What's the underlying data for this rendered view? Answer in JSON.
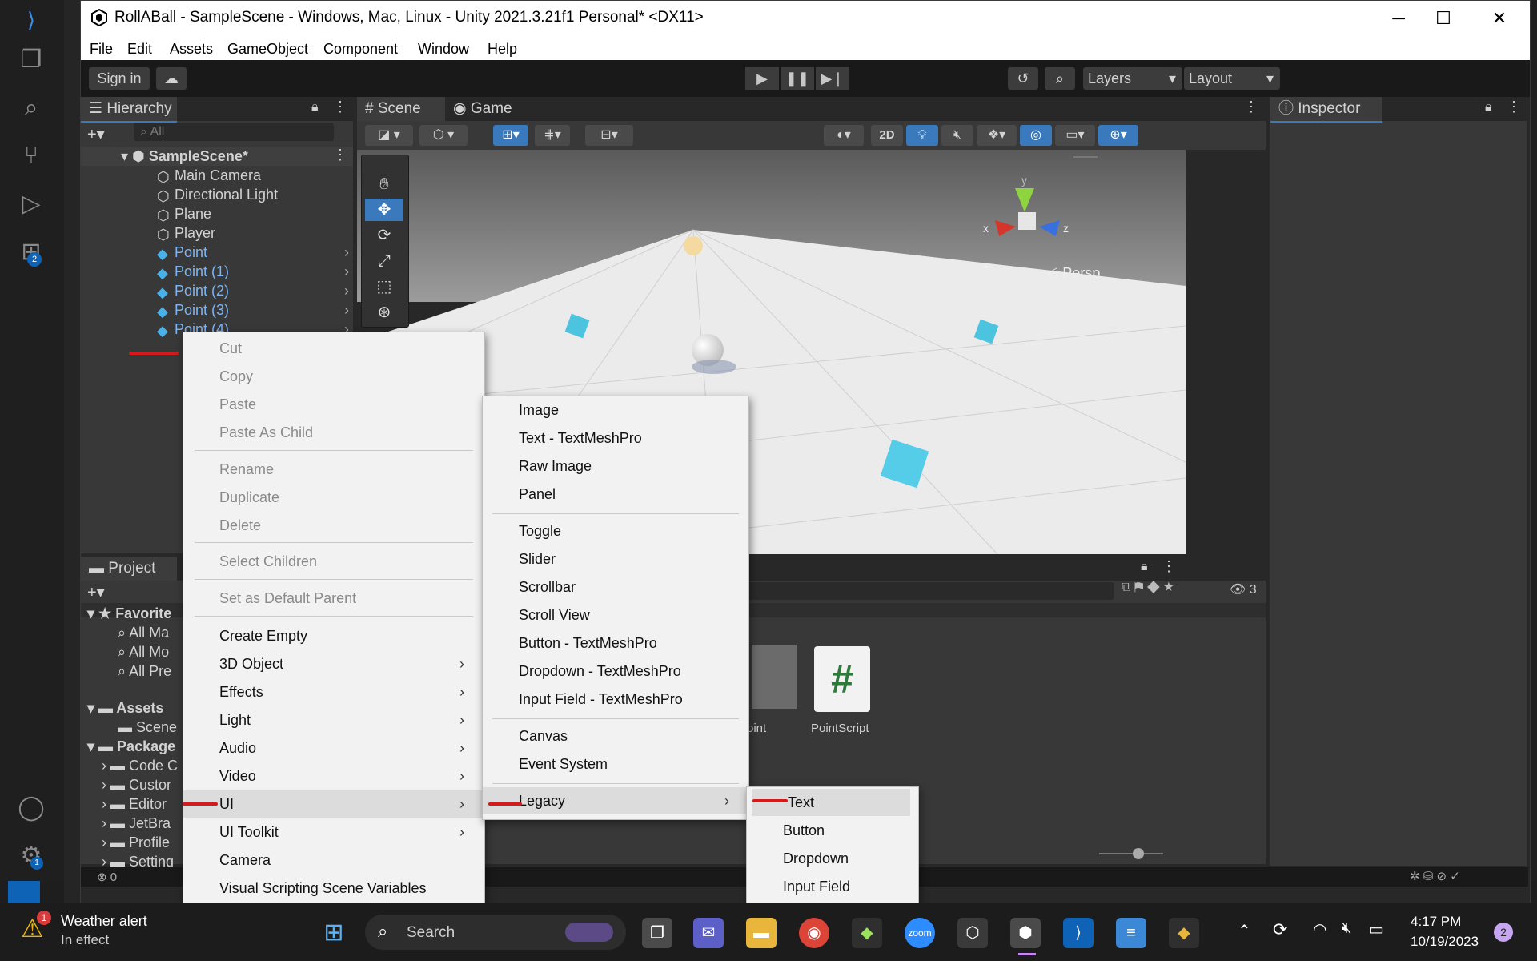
{
  "window": {
    "title": "RollABall - SampleScene - Windows, Mac, Linux - Unity 2021.3.21f1 Personal* <DX11>",
    "minimize": "─",
    "maximize": "☐",
    "close": "✕"
  },
  "menubar": [
    "File",
    "Edit",
    "Assets",
    "GameObject",
    "Component",
    "Window",
    "Help"
  ],
  "toolbar": {
    "sign_in": "Sign in",
    "layers": "Layers",
    "layout": "Layout"
  },
  "hierarchy": {
    "tab": "Hierarchy",
    "search_placeholder": "All",
    "scene": "SampleScene*",
    "items": [
      "Main Camera",
      "Directional Light",
      "Plane",
      "Player"
    ],
    "prefab_items": [
      "Point",
      "Point (1)",
      "Point (2)",
      "Point (3)",
      "Point (4)"
    ]
  },
  "scene_tabs": {
    "scene": "Scene",
    "game": "Game",
    "mode_2d": "2D",
    "persp": "Persp",
    "axis_x": "x",
    "axis_y": "y",
    "axis_z": "z"
  },
  "inspector": {
    "tab": "Inspector"
  },
  "project": {
    "tab": "Project",
    "favorites_label": "Favorite",
    "favorites": [
      "All Ma",
      "All Mo",
      "All Pre"
    ],
    "assets_label": "Assets",
    "assets_children": [
      "Scene"
    ],
    "packages_label": "Package",
    "packages": [
      "Code C",
      "Custor",
      "Editor",
      "JetBra",
      "Profile",
      "Setting"
    ],
    "asset_files": [
      "oint",
      "PointScript"
    ],
    "hidden_count": "3"
  },
  "context_menu": {
    "items": [
      {
        "label": "Cut",
        "disabled": true
      },
      {
        "label": "Copy",
        "disabled": true
      },
      {
        "label": "Paste",
        "disabled": true
      },
      {
        "label": "Paste As Child",
        "disabled": true
      },
      {
        "label": "Rename",
        "disabled": true
      },
      {
        "label": "Duplicate",
        "disabled": true
      },
      {
        "label": "Delete",
        "disabled": true
      },
      {
        "label": "Select Children",
        "disabled": true
      },
      {
        "label": "Set as Default Parent",
        "disabled": true
      },
      {
        "label": "Create Empty",
        "disabled": false
      },
      {
        "label": "3D Object",
        "disabled": false
      },
      {
        "label": "Effects",
        "disabled": false
      },
      {
        "label": "Light",
        "disabled": false
      },
      {
        "label": "Audio",
        "disabled": false
      },
      {
        "label": "Video",
        "disabled": false
      },
      {
        "label": "UI",
        "disabled": false
      },
      {
        "label": "UI Toolkit",
        "disabled": false
      },
      {
        "label": "Camera",
        "disabled": false
      },
      {
        "label": "Visual Scripting Scene Variables",
        "disabled": false
      }
    ]
  },
  "ui_submenu": {
    "items": [
      "Image",
      "Text - TextMeshPro",
      "Raw Image",
      "Panel",
      "Toggle",
      "Slider",
      "Scrollbar",
      "Scroll View",
      "Button - TextMeshPro",
      "Dropdown - TextMeshPro",
      "Input Field - TextMeshPro",
      "Canvas",
      "Event System",
      "Legacy"
    ]
  },
  "legacy_submenu": {
    "items": [
      "Text",
      "Button",
      "Dropdown",
      "Input Field"
    ]
  },
  "status_bar": {
    "errors": "0"
  },
  "taskbar": {
    "weather_title": "Weather alert",
    "weather_sub": "In effect",
    "weather_badge": "1",
    "search": "Search",
    "time": "4:17 PM",
    "date": "10/19/2023",
    "notif_count": "2",
    "vs_badge_accounts": "1",
    "vs_badge_ext": "2"
  }
}
